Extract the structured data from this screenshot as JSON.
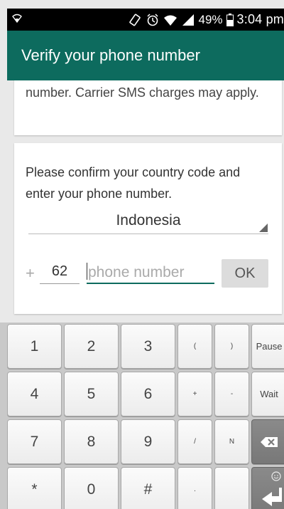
{
  "status_bar": {
    "battery_percent": "49%",
    "time": "3:04 pm",
    "icons": [
      "wifi-icon",
      "rotate-icon",
      "alarm-icon",
      "wifi-icon",
      "signal-icon",
      "battery-icon"
    ]
  },
  "app_bar": {
    "title": "Verify your phone number"
  },
  "card1": {
    "text": "number. Carrier SMS charges may apply."
  },
  "card2": {
    "instruction": "Please confirm your country code and enter your phone number.",
    "country": "Indonesia",
    "plus": "+",
    "country_code": "62",
    "phone_placeholder": "phone number",
    "ok_label": "OK"
  },
  "keyboard": {
    "rows": [
      [
        "1",
        "2",
        "3",
        "(",
        ")",
        "Pause"
      ],
      [
        "4",
        "5",
        "6",
        "+",
        "-",
        "Wait"
      ],
      [
        "7",
        "8",
        "9",
        "/",
        "N",
        "backspace"
      ],
      [
        "*",
        "0",
        "#",
        ".",
        "",
        "enter"
      ]
    ]
  },
  "colors": {
    "accent": "#0d6b5e",
    "status_bar": "#000000",
    "background": "#e9e9e9"
  }
}
